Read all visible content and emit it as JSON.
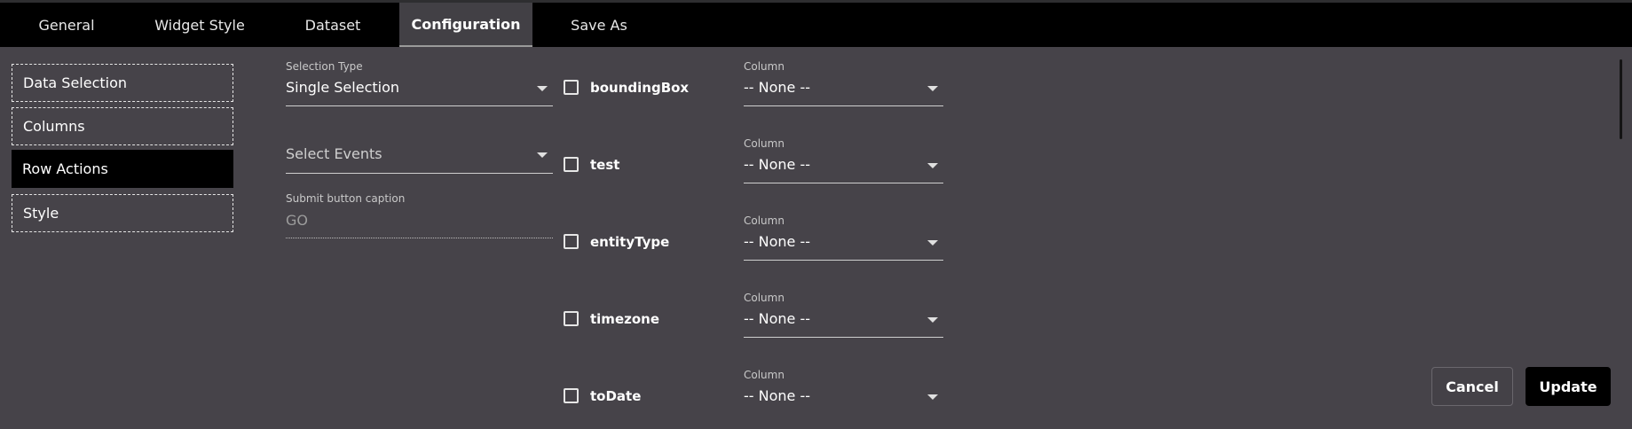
{
  "tabs": [
    "General",
    "Widget Style",
    "Dataset",
    "Configuration",
    "Save As"
  ],
  "active_tab": "Configuration",
  "sidebar": {
    "items": [
      "Data Selection",
      "Columns",
      "Row Actions",
      "Style"
    ],
    "active": "Row Actions"
  },
  "form": {
    "selection_type": {
      "label": "Selection Type",
      "value": "Single Selection"
    },
    "select_events": {
      "placeholder": "Select Events"
    },
    "submit_caption": {
      "label": "Submit button caption",
      "value": "GO"
    }
  },
  "fields": [
    {
      "name": "boundingBox",
      "column_label": "Column",
      "column_value": "-- None --",
      "checked": false
    },
    {
      "name": "test",
      "column_label": "Column",
      "column_value": "-- None --",
      "checked": false
    },
    {
      "name": "entityType",
      "column_label": "Column",
      "column_value": "-- None --",
      "checked": false
    },
    {
      "name": "timezone",
      "column_label": "Column",
      "column_value": "-- None --",
      "checked": false
    },
    {
      "name": "toDate",
      "column_label": "Column",
      "column_value": "-- None --",
      "checked": false
    }
  ],
  "buttons": {
    "cancel": "Cancel",
    "update": "Update"
  },
  "colors": {
    "background": "#464349",
    "topbar": "#000000",
    "active_item": "#000000"
  }
}
